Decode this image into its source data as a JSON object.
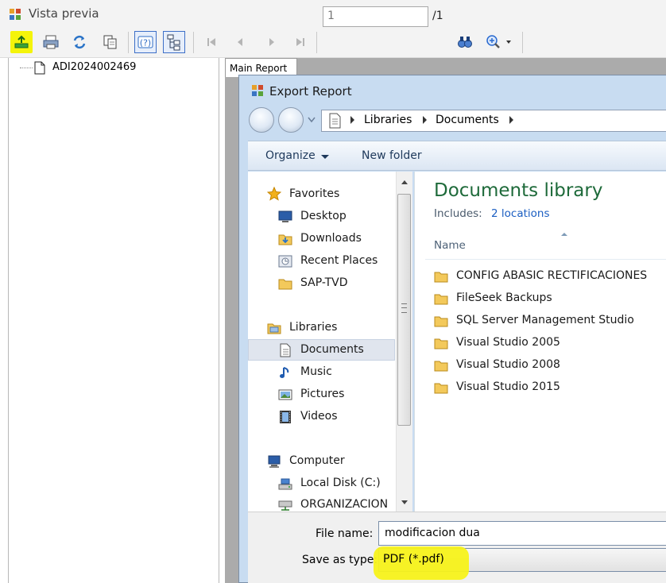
{
  "window": {
    "title": "Vista previa"
  },
  "toolbar": {
    "page_input": "1",
    "page_total": "/1",
    "buttons": [
      "export-icon",
      "print-icon",
      "refresh-icon",
      "copy-icon",
      "help-icon",
      "group-tree-icon",
      "first-page-icon",
      "previous-page-icon",
      "next-page-icon",
      "last-page-icon",
      "find-icon",
      "zoom-icon"
    ],
    "highlight_color": "#f4f40a"
  },
  "tree": {
    "root_label": "ADI2024002469"
  },
  "report": {
    "tab_label": "Main Report"
  },
  "dialog": {
    "title": "Export Report",
    "address": [
      "Libraries",
      "Documents"
    ],
    "organize_label": "Organize",
    "new_folder_label": "New folder",
    "nav": {
      "favorites": "Favorites",
      "desktop": "Desktop",
      "downloads": "Downloads",
      "recent_places": "Recent Places",
      "sap_tvd": "SAP-TVD",
      "libraries": "Libraries",
      "documents": "Documents",
      "music": "Music",
      "pictures": "Pictures",
      "videos": "Videos",
      "computer": "Computer",
      "local_disk": "Local Disk (C:)",
      "organizacion": "ORGANIZACION"
    },
    "library_title": "Documents library",
    "includes_label": "Includes:",
    "locations_link": "2 locations",
    "column_name": "Name",
    "folders": [
      "CONFIG ABASIC RECTIFICACIONES",
      "FileSeek Backups",
      "SQL Server Management Studio",
      "Visual Studio 2005",
      "Visual Studio 2008",
      "Visual Studio 2015"
    ],
    "file_name_label": "File name:",
    "file_name_value": "modificacion dua",
    "save_type_label": "Save as type:",
    "save_type_value": "PDF (*.pdf)"
  }
}
